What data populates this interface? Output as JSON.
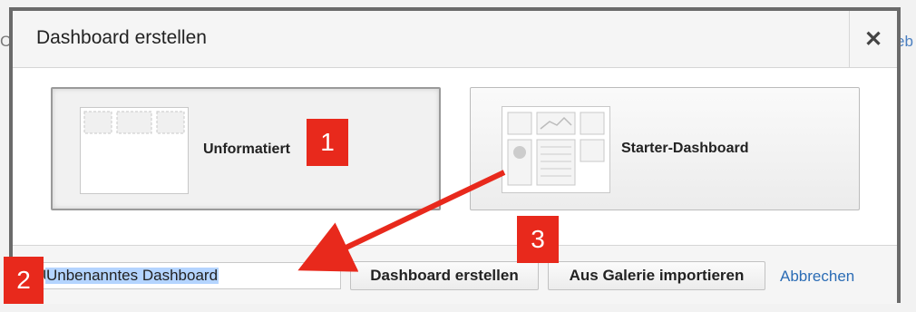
{
  "background": {
    "left_fragment": "C",
    "right_fragment": "eb"
  },
  "dialog": {
    "title": "Dashboard erstellen",
    "close_icon": "close-icon"
  },
  "templates": [
    {
      "label": "Unformatiert",
      "selected": true,
      "icon": "blank-layout-icon"
    },
    {
      "label": "Starter-Dashboard",
      "selected": false,
      "icon": "starter-layout-icon"
    }
  ],
  "footer": {
    "name_value": "Unbenanntes Dashboard",
    "create_label": "Dashboard erstellen",
    "import_label": "Aus Galerie importieren",
    "cancel_label": "Abbrechen"
  },
  "annotations": {
    "badge_1": "1",
    "badge_2": "2",
    "badge_3": "3"
  },
  "colors": {
    "annotation_red": "#e8291c",
    "link_blue": "#2b6cb5",
    "selection_blue": "#b4d4ff"
  }
}
